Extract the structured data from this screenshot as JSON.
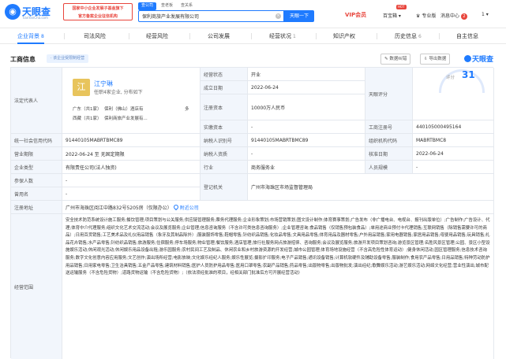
{
  "header": {
    "logo_text": "天眼查",
    "logo_domain": "TianYanCha.com",
    "gov_badge_line1": "国家中小企业发展子基金旗下",
    "gov_badge_line2": "官方备案企业征信机构",
    "search_tabs": [
      "查公司",
      "查老板",
      "查关系"
    ],
    "search_value": "保利商旅产业发展有限公司",
    "search_button": "天眼一下",
    "vip_label": "VIP会员",
    "nav_items": [
      "百宝箱",
      "专业版",
      "消息中心"
    ],
    "hot_badge": "HOT",
    "message_count": "2",
    "user_label": "1"
  },
  "tabs": [
    {
      "label": "企业背景",
      "count": "8"
    },
    {
      "label": "司法风险",
      "count": ""
    },
    {
      "label": "经营风险",
      "count": ""
    },
    {
      "label": "公司发展",
      "count": ""
    },
    {
      "label": "经营状况",
      "count": "1"
    },
    {
      "label": "知识产权",
      "count": ""
    },
    {
      "label": "历史信息",
      "count": "6"
    },
    {
      "label": "自主信息",
      "count": ""
    }
  ],
  "section": {
    "title": "工商信息",
    "warn_tag": "· 该企业受限制经营",
    "btn_download": "数据纠错",
    "btn_export": "导出数据",
    "brand": "天眼查"
  },
  "legal": {
    "label": "法定代表人",
    "avatar": "江",
    "name": "江宁琳",
    "sub": "任职4家企业, 分布如下",
    "companies_line1": [
      "广东（共1家）",
      "保利（佛山）酒店有",
      "多"
    ],
    "companies_line2": [
      "西藏（共1家）",
      "保利商旅产业发展有..."
    ]
  },
  "fields": {
    "status_label": "经营状态",
    "status": "开业",
    "estab_label": "成立日期",
    "estab": "2022-06-24",
    "capital_label": "注册资本",
    "capital": "10000万人民币",
    "paid_label": "实缴资本",
    "paid": "-",
    "score_label": "天眼评分",
    "score_title": "评分",
    "score": "31",
    "reg_no_label": "工商注册号",
    "reg_no": "440105000495164",
    "credit_label": "统一社会信用代码",
    "credit": "91440105MABRTBMC89",
    "taxid_label": "纳税人识别号",
    "taxid": "91440105MABRTBMC89",
    "org_label": "组织机构代码",
    "org": "MABRTBMC8",
    "term_label": "营业期限",
    "term": "2022-06-24 至 无固定期限",
    "taxpayer_label": "纳税人资质",
    "taxpayer": "-",
    "approve_label": "核准日期",
    "approve": "2022-06-24",
    "type_label": "企业类型",
    "type": "有限责任公司(法人独资)",
    "industry_label": "行业",
    "industry": "商务服务业",
    "staff_label": "人员规模",
    "staff": "-",
    "insured_label": "参保人数",
    "insured": "-",
    "authority_label": "登记机关",
    "authority": "广州市海珠区市场监督管理局",
    "former_label": "曾用名",
    "former": "-",
    "english_label": "英文名称",
    "english": "-",
    "address_label": "注册地址",
    "address": "广州市海珠区阅江中路832号5205房（仅限办公）",
    "nearby": "附近公司",
    "scope_label": "经营范围",
    "scope": "安全技术防范系统设计施工服务;餐饮管理;项目策划与公关服务;供应链管理服务;票务代理服务;企业形象策划;市场营销策划;图文设计制作;体育赛事策划;广告发布（非广播电台、电视台、报刊出版单位）;广告制作;广告设计、代理;体育中介代理服务;组织文化艺术交流活动;会议及展览服务;企业管理;信息咨询服务（不含许可类信息咨询服务）;企业管理咨询;食品销售（仅销售预包装食品）;单用途商业预付卡代理销售;互联网销售（除销售需要许可的商品）;日用百货销售;工艺美术品及礼仪用品销售（象牙及其制品除外）;服装服饰零售;鞋帽零售;针纺织品销售;化妆品零售;文具用品零售;体育用品及器材零售;户外用品销售;家用电器销售;家居用品销售;母婴用品销售;玩具销售;礼品花卉销售;水产品零售;针纺织品销售;旅游服务;住宿服务;停车场服务;物业管理;餐饮服务;酒店管理;旅行社服务网点旅游招徕、咨询服务;会议及展览服务;旅游开发项目策划咨询;游览景区管理;名胜风景区管理;公园、景区小型设施娱乐活动;休闲观光活动;休闲娱乐用品设备出租;游乐园服务;农村民间工艺及制品、休闲农业和乡村旅游资源的开发经营;城市公园管理;体育场地设施经营（不含高危险性体育运动）;健身休闲活动;园区管理服务;信息技术咨询服务;数字文化创意内容应用服务;文艺创作;演出场所经营;电影放映;文化娱乐经纪人服务;娱乐性展览;摄影扩印服务;电子产品销售;通讯设备销售;计算机软硬件及辅助设备零售;服装制作;食用农产品零售;日用品销售;特种劳动防护用品销售;日用家电零售;卫生洁具销售;五金产品零售;建筑材料销售;医护人员防护用品零售;医用口罩零售;农副产品销售;药品零售;出版物零售;出版物批发;演出经纪;歌舞娱乐活动;游艺娱乐活动;网络文化经营;营业性演出;城市配送运输服务（不含危险货物）;道路货物运输（不含危险货物）;（依法须经批准的项目，经相关部门批准后方可开展经营活动）"
  }
}
